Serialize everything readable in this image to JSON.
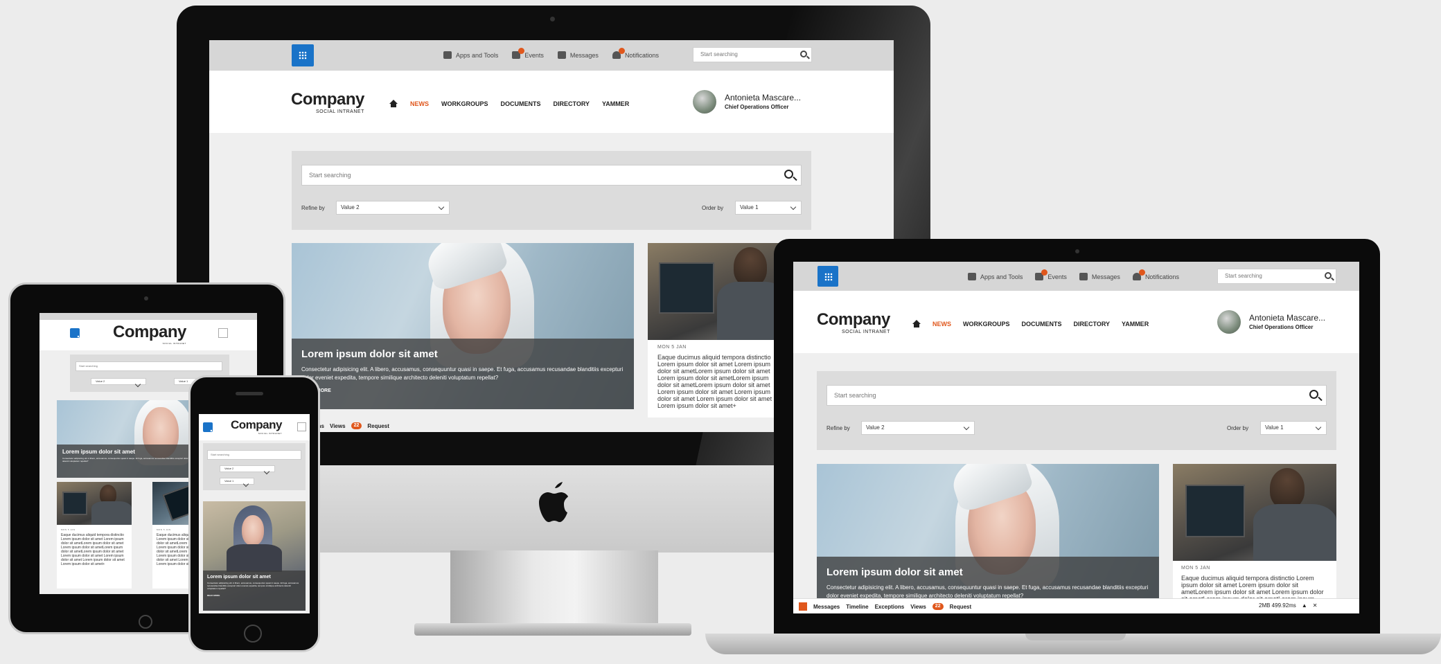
{
  "colors": {
    "accent": "#e0571c",
    "apps_blue": "#1a73c8",
    "bezel": "#0e0e0e",
    "page_bg": "#efefef"
  },
  "icons": {
    "apps": "apps-grid-icon",
    "events": "calendar-icon",
    "messages": "envelope-icon",
    "notifications": "bell-icon",
    "search": "search-icon",
    "home": "home-icon",
    "menu": "hamburger-menu-icon",
    "brand": "apple-logo-icon"
  },
  "topbar": {
    "apps_label": "Apps and Tools",
    "events_label": "Events",
    "messages_label": "Messages",
    "notifications_label": "Notifications",
    "search_placeholder": "Start searching"
  },
  "header": {
    "company": "Company",
    "tagline": "SOCIAL INTRANET",
    "nav": [
      "NEWS",
      "WORKGROUPS",
      "DOCUMENTS",
      "DIRECTORY",
      "YAMMER"
    ],
    "user_name": "Antonieta Mascare...",
    "user_role": "Chief Operations Officer"
  },
  "search": {
    "placeholder": "Start searching",
    "refine_label": "Refine by",
    "refine_value": "Value 2",
    "order_label": "Order by",
    "order_value": "Value 1"
  },
  "hero": {
    "title": "Lorem ipsum dolor sit amet",
    "body": "Consectetur adipisicing elit. A libero, accusamus, consequuntur quasi in saepe. Et fuga, accusamus recusandae blanditiis excepturi dolor eveniet expedita, tempore similique architecto deleniti voluptatum repellat?",
    "more": "READ MORE"
  },
  "side_article": {
    "date": "MON 5 JAN",
    "body": "Eaque ducimus aliquid tempora distinctio Lorem ipsum dolor sit amet Lorem ipsum dolor sit ametLorem ipsum dolor sit amet Lorem ipsum dolor sit ametLorem ipsum dolor sit ametLorem ipsum dolor sit amet Lorem ipsum dolor sit amet Lorem ipsum dolor sit amet Lorem ipsum dolor sit amet Lorem ipsum dolor sit amet+"
  },
  "imac_strip": {
    "first": "...ns",
    "views": "Views",
    "views_count": "22",
    "request": "Request"
  },
  "laptop_strip": {
    "items": [
      "Messages",
      "Timeline",
      "Exceptions",
      "Views"
    ],
    "views_count": "22",
    "request": "Request",
    "right": "2MB   499.92ms"
  },
  "tablet": {
    "article_date_1": "MON 5 JAN",
    "article_date_2": "MON 5 JAN"
  }
}
